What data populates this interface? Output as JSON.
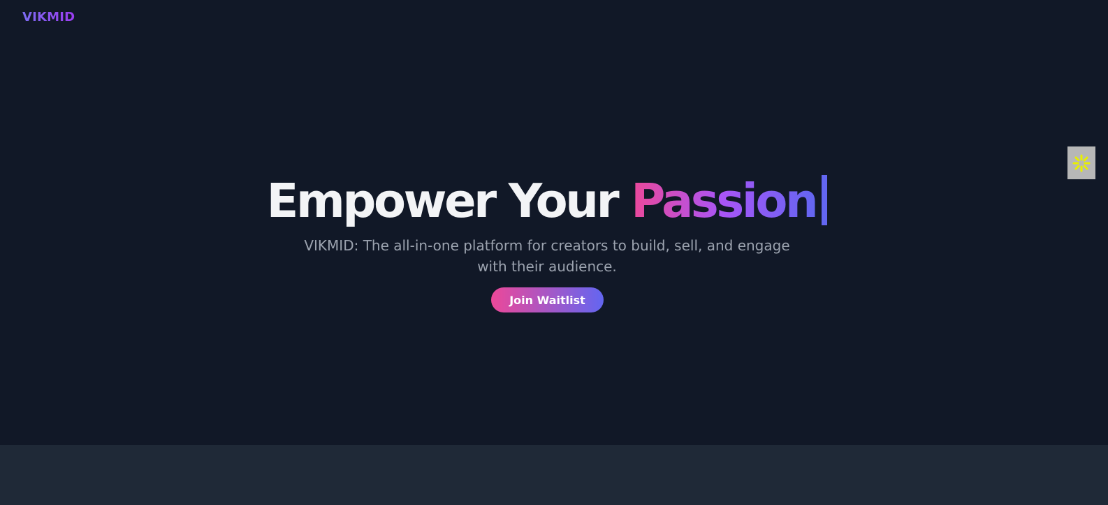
{
  "brand": {
    "name": "VIKMID"
  },
  "hero": {
    "headline_prefix": "Empower Your",
    "headline_accent": "Passion",
    "subtitle": "VIKMID: The all-in-one platform for creators to build, sell, and engage with their audience.",
    "cta_label": "Join Waitlist"
  },
  "side_widget": {
    "icon": "sparkle-icon"
  },
  "colors": {
    "background": "#111827",
    "footer_band": "#1f2937",
    "accent_pink": "#ec4899",
    "accent_purple": "#a855f7",
    "accent_indigo": "#6366f1",
    "subtext": "#9ca3af",
    "widget_icon": "#e8f000"
  }
}
